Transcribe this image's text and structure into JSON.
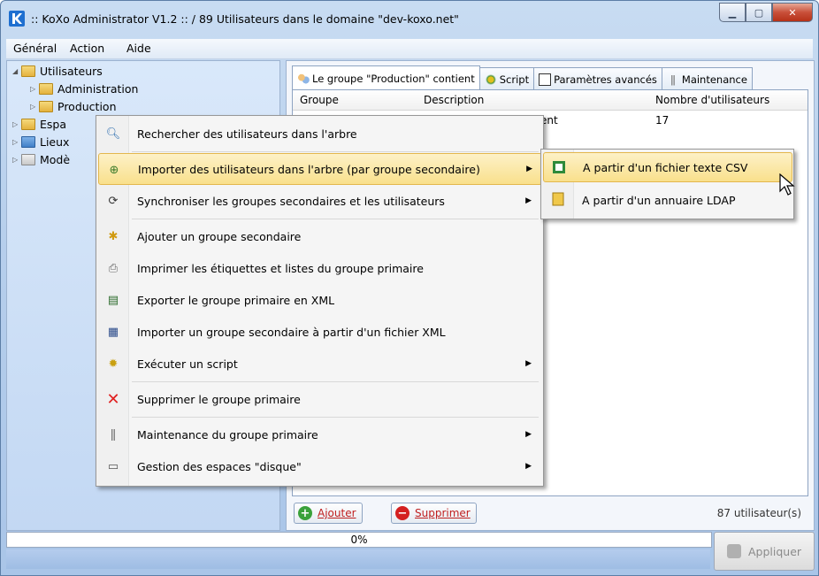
{
  "window": {
    "title": ":: KoXo Administrator V1.2 :: / 89 Utilisateurs dans le domaine \"dev-koxo.net\"",
    "minimize_icon": "minimize-icon",
    "maximize_icon": "maximize-icon",
    "close_icon": "close-icon"
  },
  "menubar": {
    "items": [
      "Général",
      "Action",
      "Aide"
    ]
  },
  "tree": {
    "items": [
      {
        "label": "Utilisateurs",
        "level": 0,
        "expanded": true
      },
      {
        "label": "Administration",
        "level": 1
      },
      {
        "label": "Production",
        "level": 1,
        "selected": true
      },
      {
        "label": "Espa",
        "level": 0
      },
      {
        "label": "Lieux",
        "level": 0
      },
      {
        "label": "Modè",
        "level": 0
      }
    ]
  },
  "tabs": [
    {
      "label": "Le groupe \"Production\" contient",
      "icon": "group-icon",
      "active": true
    },
    {
      "label": "Script",
      "icon": "script-icon"
    },
    {
      "label": "Paramètres avancés",
      "icon": "settings-icon"
    },
    {
      "label": "Maintenance",
      "icon": "tools-icon"
    }
  ],
  "grid": {
    "columns": [
      "Groupe",
      "Description",
      "Nombre d'utilisateurs"
    ],
    "rows": [
      {
        "partial_desc": "ent",
        "count": "17"
      }
    ]
  },
  "buttons": {
    "add": "Ajouter",
    "delete": "Supprimer",
    "apply": "Appliquer"
  },
  "status": {
    "user_count": "87 utilisateur(s)",
    "progress": "0%"
  },
  "context_menu": {
    "items": [
      {
        "label": "Rechercher des utilisateurs dans l'arbre",
        "icon": "search-icon",
        "submenu": false
      },
      {
        "label": "Importer des utilisateurs dans l'arbre (par groupe secondaire)",
        "icon": "import-users-icon",
        "submenu": true,
        "highlighted": true
      },
      {
        "label": "Synchroniser les groupes secondaires et les utilisateurs",
        "icon": "sync-icon",
        "submenu": true
      },
      {
        "label": "Ajouter un groupe secondaire",
        "icon": "add-group-icon",
        "submenu": false
      },
      {
        "label": "Imprimer les étiquettes et listes du groupe primaire",
        "icon": "print-icon",
        "submenu": false
      },
      {
        "label": "Exporter le groupe primaire en XML",
        "icon": "export-xml-icon",
        "submenu": false
      },
      {
        "label": "Importer un groupe secondaire à partir d'un fichier XML",
        "icon": "import-xml-icon",
        "submenu": false
      },
      {
        "label": "Exécuter un script",
        "icon": "script-icon",
        "submenu": true
      },
      {
        "label": "Supprimer le groupe primaire",
        "icon": "delete-icon",
        "submenu": false
      },
      {
        "label": "Maintenance du groupe primaire",
        "icon": "tools-icon",
        "submenu": true
      },
      {
        "label": "Gestion des espaces \"disque\"",
        "icon": "disk-icon",
        "submenu": true
      }
    ]
  },
  "submenu": {
    "items": [
      {
        "label": "A partir d'un fichier texte CSV",
        "icon": "csv-file-icon",
        "highlighted": true
      },
      {
        "label": "A partir d'un annuaire LDAP",
        "icon": "ldap-icon"
      }
    ]
  },
  "colors": {
    "window_bg": "#b7cfec",
    "highlight": "#f9e08c",
    "delete_red": "#d42020",
    "add_green": "#3aa13a"
  }
}
